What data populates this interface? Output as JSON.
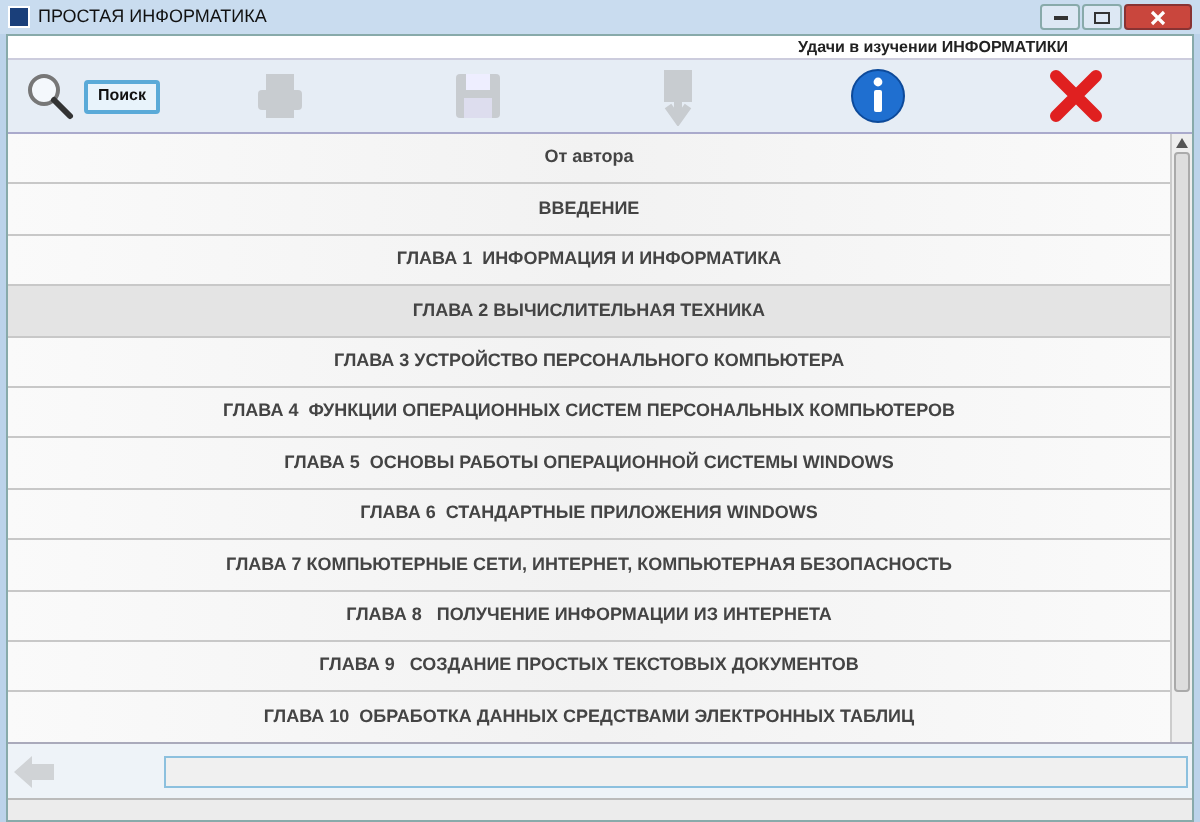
{
  "window": {
    "title": "ПРОСТАЯ ИНФОРМАТИКА"
  },
  "greeting": "Удачи в изучении ИНФОРМАТИКИ",
  "toolbar": {
    "search_button": "Поиск",
    "tools": [
      {
        "kind": "print",
        "disabled": true
      },
      {
        "kind": "save",
        "disabled": true
      },
      {
        "kind": "export",
        "disabled": true
      },
      {
        "kind": "info",
        "disabled": false
      },
      {
        "kind": "exit",
        "disabled": false
      }
    ]
  },
  "chapters": [
    {
      "label": "От автора",
      "selected": false
    },
    {
      "label": "ВВЕДЕНИЕ",
      "selected": false
    },
    {
      "label": "ГЛАВА 1  ИНФОРМАЦИЯ И ИНФОРМАТИКА",
      "selected": false
    },
    {
      "label": "ГЛАВА 2 ВЫЧИСЛИТЕЛЬНАЯ ТЕХНИКА",
      "selected": true
    },
    {
      "label": "ГЛАВА 3 УСТРОЙСТВО ПЕРСОНАЛЬНОГО КОМПЬЮТЕРА",
      "selected": false
    },
    {
      "label": "ГЛАВА 4  ФУНКЦИИ ОПЕРАЦИОННЫХ СИСТЕМ ПЕРСОНАЛЬНЫХ КОМПЬЮТЕРОВ",
      "selected": false
    },
    {
      "label": "ГЛАВА 5  ОСНОВЫ РАБОТЫ ОПЕРАЦИОННОЙ СИСТЕМЫ WINDOWS",
      "selected": false
    },
    {
      "label": "ГЛАВА 6  СТАНДАРТНЫЕ ПРИЛОЖЕНИЯ WINDOWS",
      "selected": false
    },
    {
      "label": "ГЛАВА 7 КОМПЬЮТЕРНЫЕ СЕТИ, ИНТЕРНЕТ, КОМПЬЮТЕРНАЯ БЕЗОПАСНОСТЬ",
      "selected": false
    },
    {
      "label": "ГЛАВА 8   ПОЛУЧЕНИЕ ИНФОРМАЦИИ ИЗ ИНТЕРНЕТА",
      "selected": false
    },
    {
      "label": "ГЛАВА 9   СОЗДАНИЕ ПРОСТЫХ ТЕКСТОВЫХ ДОКУМЕНТОВ",
      "selected": false
    },
    {
      "label": "ГЛАВА 10  ОБРАБОТКА ДАННЫХ СРЕДСТВАМИ ЭЛЕКТРОННЫХ ТАБЛИЦ",
      "selected": false
    }
  ]
}
